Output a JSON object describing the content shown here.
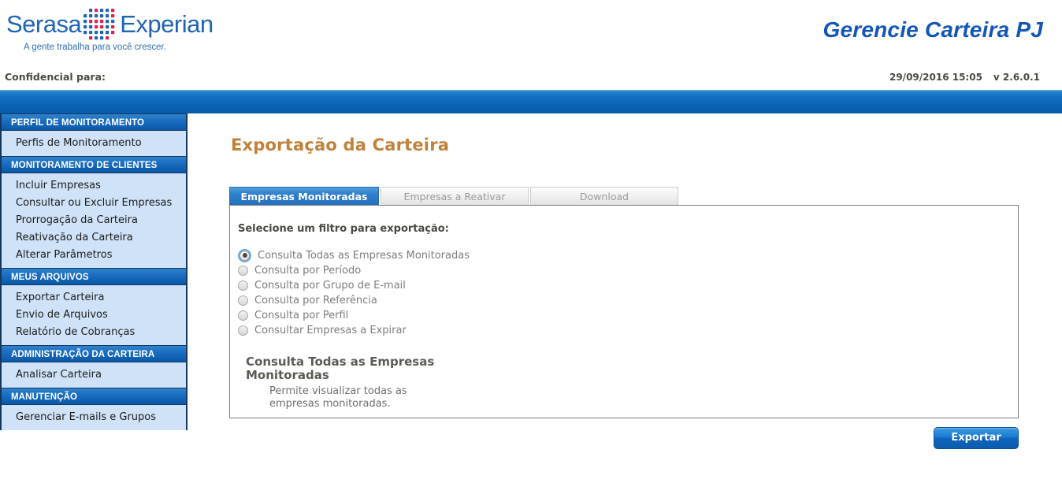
{
  "header": {
    "logo": {
      "word1": "Serasa",
      "word2": "Experian",
      "tagline": "A gente trabalha para você crescer.",
      "dots_icon": "dot-matrix-logo-icon",
      "blue": "#1e64b4",
      "red": "#e01f4a"
    },
    "app_title": "Gerencie Carteira PJ",
    "app_title_color": "#1256b8"
  },
  "confidential": {
    "label": "Confidencial para:",
    "datetime": "29/09/2016 15:05",
    "version": "v 2.6.0.1"
  },
  "sidebar": {
    "groups": [
      {
        "title": "PERFIL DE MONITORAMENTO",
        "items": [
          {
            "label": "Perfis de Monitoramento"
          }
        ]
      },
      {
        "title": "MONITORAMENTO DE CLIENTES",
        "items": [
          {
            "label": "Incluir Empresas"
          },
          {
            "label": "Consultar ou Excluir Empresas"
          },
          {
            "label": "Prorrogação da Carteira"
          },
          {
            "label": "Reativação da Carteira"
          },
          {
            "label": "Alterar Parâmetros"
          }
        ]
      },
      {
        "title": "MEUS ARQUIVOS",
        "items": [
          {
            "label": "Exportar Carteira"
          },
          {
            "label": "Envio de Arquivos"
          },
          {
            "label": "Relatório de Cobranças"
          }
        ]
      },
      {
        "title": "ADMINISTRAÇÃO DA CARTEIRA",
        "items": [
          {
            "label": "Analisar Carteira"
          }
        ]
      },
      {
        "title": "MANUTENÇÃO",
        "items": [
          {
            "label": "Gerenciar E-mails e Grupos"
          }
        ]
      }
    ]
  },
  "main": {
    "page_title": "Exportação da Carteira",
    "page_title_color": "#c1813a",
    "tabs": [
      {
        "label": "Empresas Monitoradas",
        "active": true
      },
      {
        "label": "Empresas a Reativar",
        "active": false
      },
      {
        "label": "Download",
        "active": false
      }
    ],
    "filter_label": "Selecione um filtro para exportação:",
    "radio_options": [
      {
        "label": "Consulta Todas as Empresas Monitoradas",
        "checked": true
      },
      {
        "label": "Consulta por Período",
        "checked": false
      },
      {
        "label": "Consulta por Grupo de E-mail",
        "checked": false
      },
      {
        "label": "Consulta por Referência",
        "checked": false
      },
      {
        "label": "Consulta por Perfil",
        "checked": false
      },
      {
        "label": "Consultar Empresas a Expirar",
        "checked": false
      }
    ],
    "description": {
      "title": "Consulta Todas as Empresas Monitoradas",
      "text": "Permite visualizar todas as empresas monitoradas."
    },
    "export_button": "Exportar"
  }
}
